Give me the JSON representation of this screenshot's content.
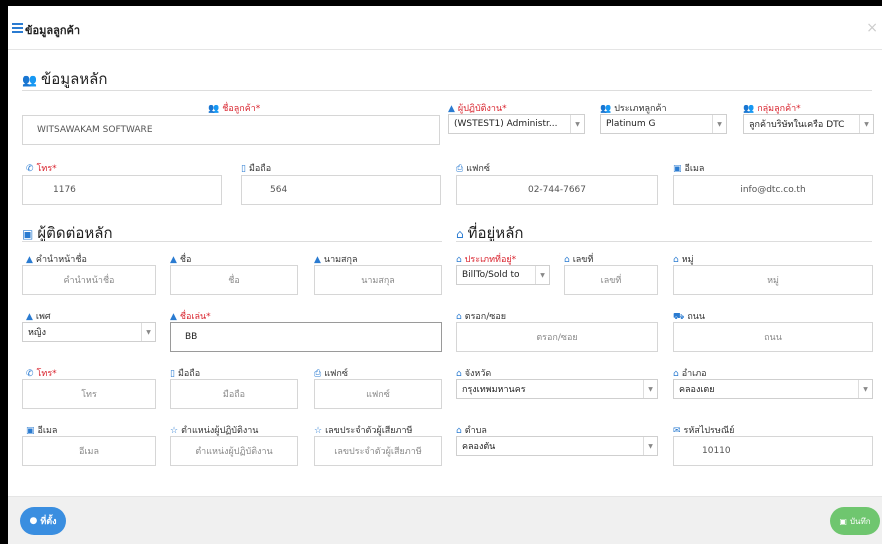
{
  "header": {
    "title": "ข้อมูลลูกค้า",
    "close": "×"
  },
  "main_section": {
    "title": "ข้อมูลหลัก"
  },
  "main": {
    "customer_name_label": "ชื่อลูกค้า*",
    "customer_name_value": "WITSAWAKAM SOFTWARE",
    "operator_label": "ผู้ปฏิบัติงาน*",
    "operator_value": "(WSTEST1) Administr...",
    "customer_type_label": "ประเภทลูกค้า",
    "customer_type_value": "Platinum G",
    "customer_group_label": "กลุ่มลูกค้า*",
    "customer_group_value": "ลูกค้าบริษัทในเครือ DTC",
    "phone_label": "โทร*",
    "phone_value": "1176",
    "mobile_label": "มือถือ",
    "mobile_value": "564",
    "fax_label": "แฟกซ์",
    "fax_value": "02-744-7667",
    "email_label": "อีเมล",
    "email_value": "info@dtc.co.th"
  },
  "contact_section": {
    "title": "ผู้ติดต่อหลัก"
  },
  "contact": {
    "prefix_label": "คำนำหน้าชื่อ",
    "prefix_placeholder": "คำนำหน้าชื่อ",
    "first_label": "ชื่อ",
    "first_placeholder": "ชื่อ",
    "last_label": "นามสกุล",
    "last_placeholder": "นามสกุล",
    "gender_label": "เพศ",
    "gender_value": "หญิง",
    "nickname_label": "ชื่อเล่น*",
    "nickname_value": "BB",
    "phone_label": "โทร*",
    "phone_placeholder": "โทร",
    "mobile_label": "มือถือ",
    "mobile_placeholder": "มือถือ",
    "fax_label": "แฟกซ์",
    "fax_placeholder": "แฟกซ์",
    "email_label": "อีเมล",
    "email_placeholder": "อีเมล",
    "position_label": "ตำแหน่งผู้ปฏิบัติงาน",
    "position_placeholder": "ตำแหน่งผู้ปฏิบัติงาน",
    "taxid_label": "เลขประจำตัวผู้เสียภาษี",
    "taxid_placeholder": "เลขประจำตัวผู้เสียภาษี"
  },
  "address_section": {
    "title": "ที่อยู่หลัก"
  },
  "address": {
    "type_label": "ประเภทที่อยู่*",
    "type_value": "BillTo/Sold to",
    "number_label": "เลขที่",
    "number_placeholder": "เลขที่",
    "moo_label": "หมู่",
    "moo_placeholder": "หมู่",
    "soi_label": "ตรอก/ซอย",
    "soi_placeholder": "ตรอก/ซอย",
    "road_label": "ถนน",
    "road_placeholder": "ถนน",
    "province_label": "จังหวัด",
    "province_value": "กรุงเทพมหานคร",
    "district_label": "อำเภอ",
    "district_value": "คลองเตย",
    "subdistrict_label": "ตำบล",
    "subdistrict_value": "คลองตัน",
    "postal_label": "รหัสไปรษณีย์",
    "postal_value": "10110"
  },
  "footer": {
    "location_label": "ที่ตั้ง",
    "save_label": "บันทึก"
  }
}
